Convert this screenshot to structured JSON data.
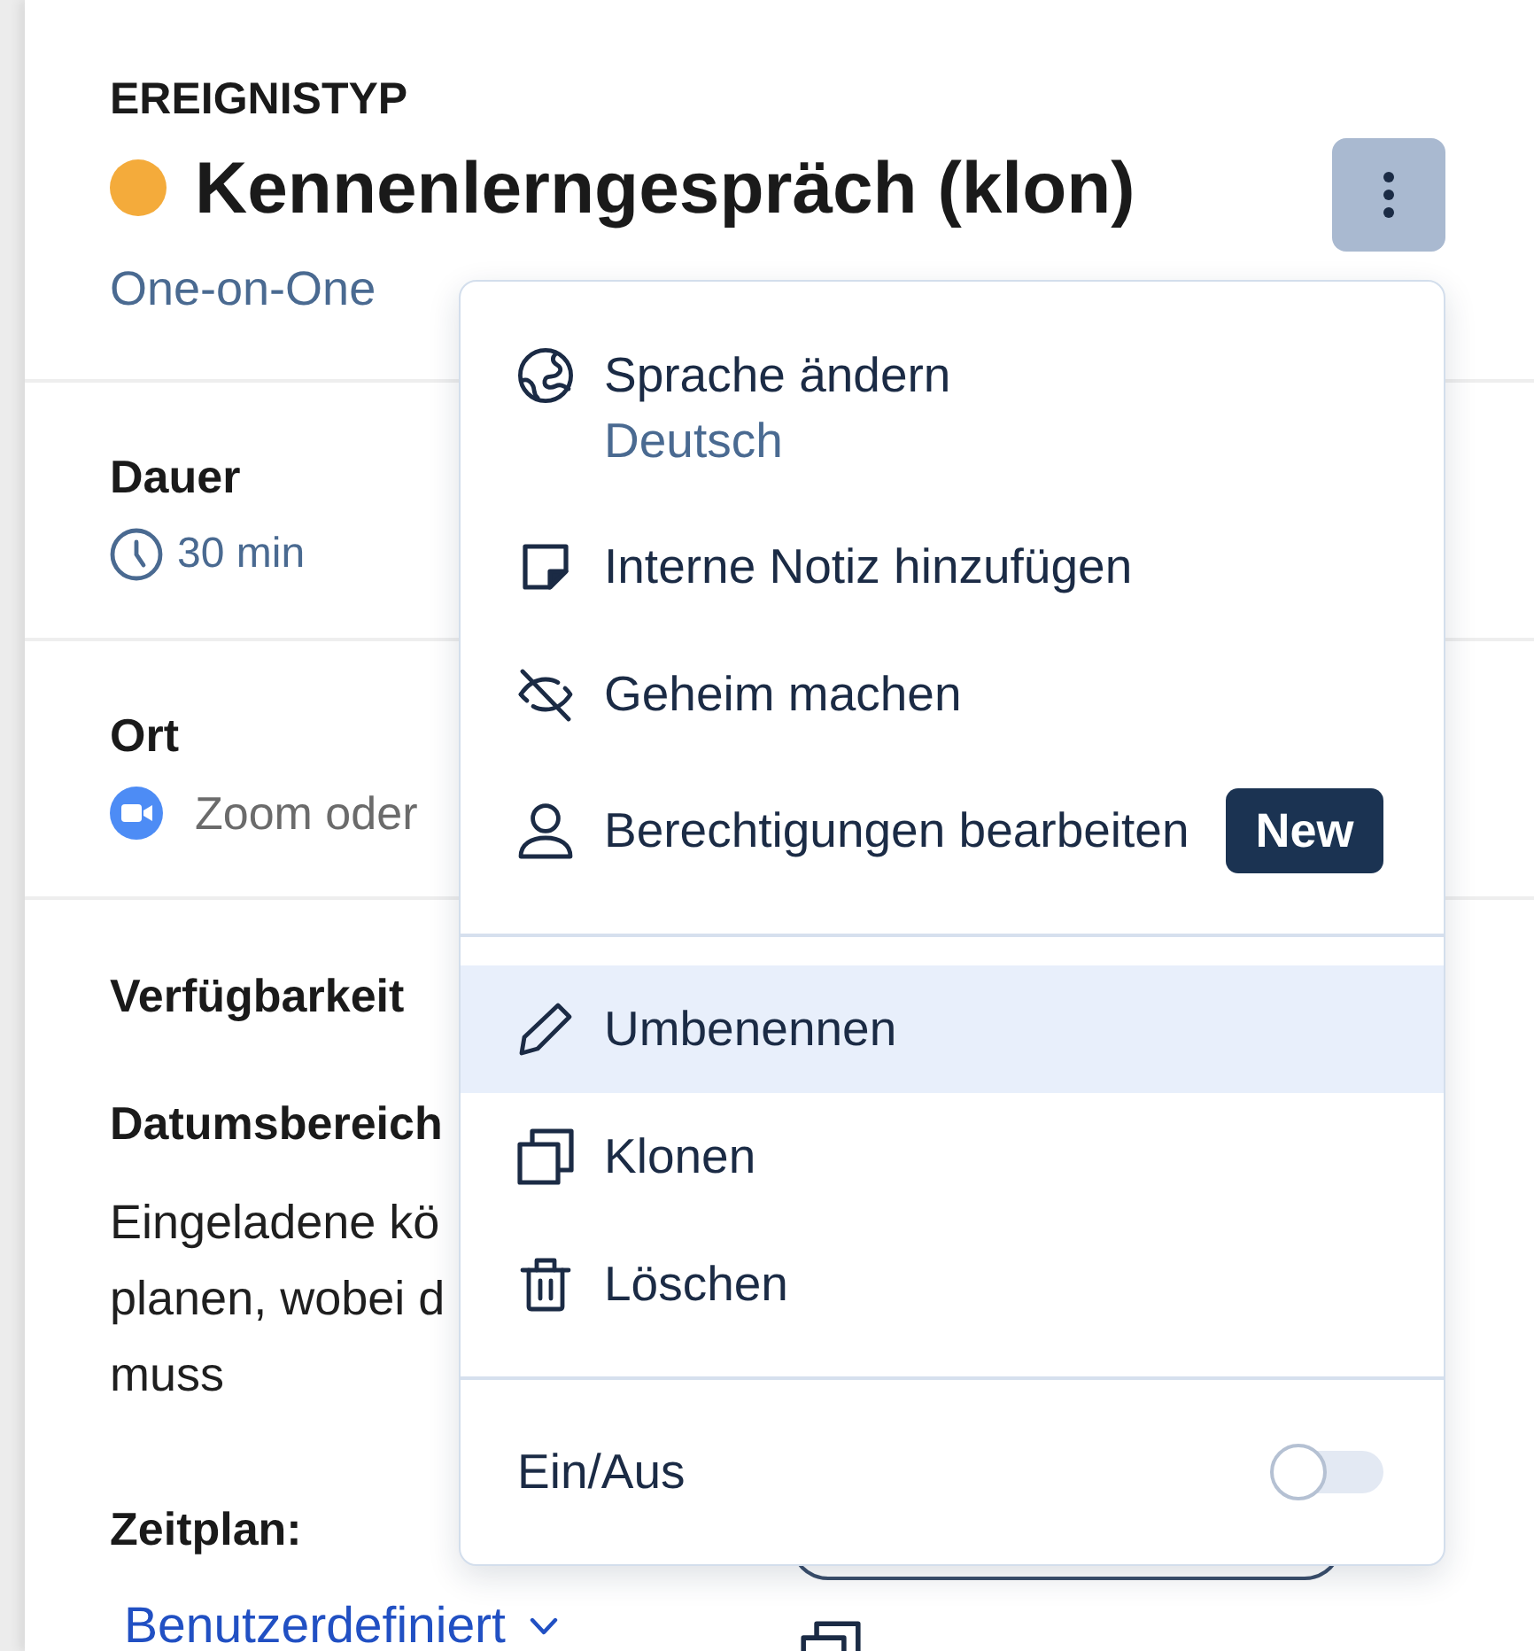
{
  "header": {
    "eyebrow": "EREIGNISTYP",
    "title": "Kennenlerngespräch (klon)",
    "subtitle": "One-on-One"
  },
  "details": [
    {
      "kind": "duration",
      "label": "Dauer",
      "value": "30 min"
    },
    {
      "kind": "location",
      "label": "Ort",
      "value": "Zoom oder"
    }
  ],
  "availability": {
    "heading": "Verfügbarkeit",
    "date_range": {
      "label": "Datumsbereich",
      "description_lines": [
        "Eingeladene kö",
        "planen, wobei d",
        "muss"
      ]
    },
    "schedule": {
      "label": "Zeitplan:",
      "value": "Benutzerdefiniert"
    }
  },
  "menu": {
    "groups": [
      {
        "items": [
          {
            "kind": "language",
            "label": "Sprache ändern",
            "sublabel": "Deutsch",
            "selected": false
          },
          {
            "kind": "note",
            "label": "Interne Notiz hinzufügen",
            "selected": false
          },
          {
            "kind": "hide",
            "label": "Geheim machen",
            "selected": false
          },
          {
            "kind": "permissions",
            "label": "Berechtigungen bearbeiten",
            "badge": "New",
            "selected": false
          }
        ]
      },
      {
        "items": [
          {
            "kind": "rename",
            "label": "Umbenennen",
            "selected": true
          },
          {
            "kind": "clone",
            "label": "Klonen",
            "selected": false
          },
          {
            "kind": "delete",
            "label": "Löschen",
            "selected": false
          }
        ]
      }
    ],
    "toggle": {
      "label": "Ein/Aus",
      "on": false
    }
  }
}
